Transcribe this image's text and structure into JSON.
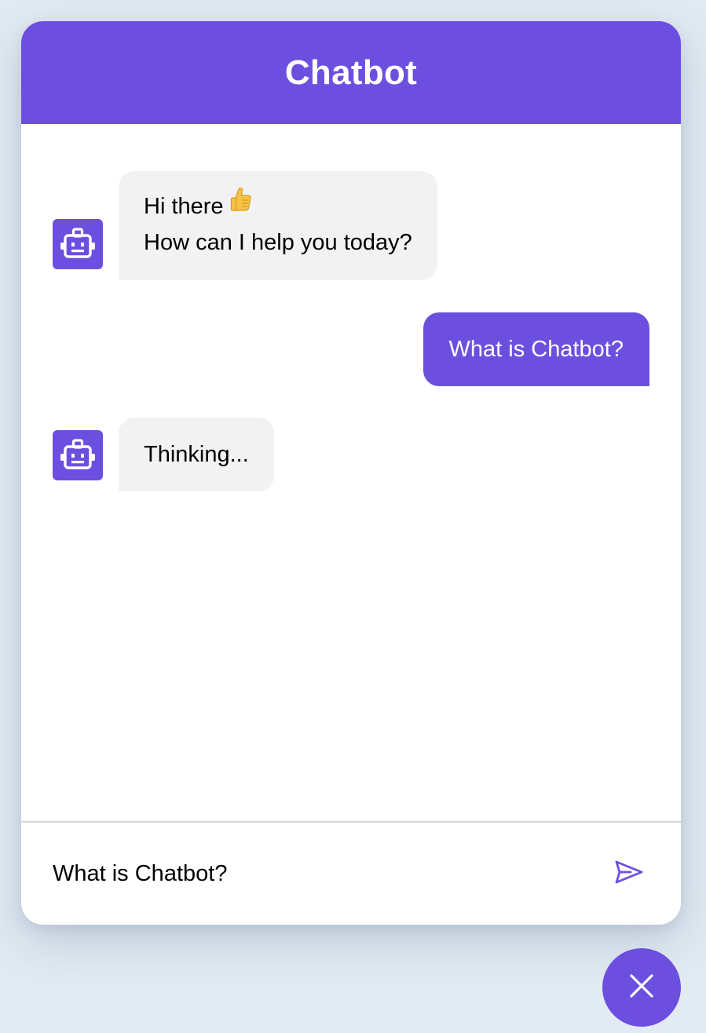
{
  "colors": {
    "background": "#e2ebf4",
    "accent": "#6d4fe0",
    "bot_bubble": "#f2f2f2",
    "user_text": "#ffffff",
    "bot_text": "#000000",
    "thumbs_up": "#f4c04a"
  },
  "header": {
    "title": "Chatbot"
  },
  "messages": [
    {
      "sender": "bot",
      "icon": "robot-icon",
      "lines": [
        "Hi there",
        "How can I help you today?"
      ],
      "emoji": "thumbs-up-icon"
    },
    {
      "sender": "user",
      "text": "What is Chatbot?"
    },
    {
      "sender": "bot",
      "icon": "robot-icon",
      "text": "Thinking..."
    }
  ],
  "input": {
    "value": "What is Chatbot?",
    "send_icon": "send-icon"
  },
  "toggler": {
    "icon": "close-icon"
  }
}
